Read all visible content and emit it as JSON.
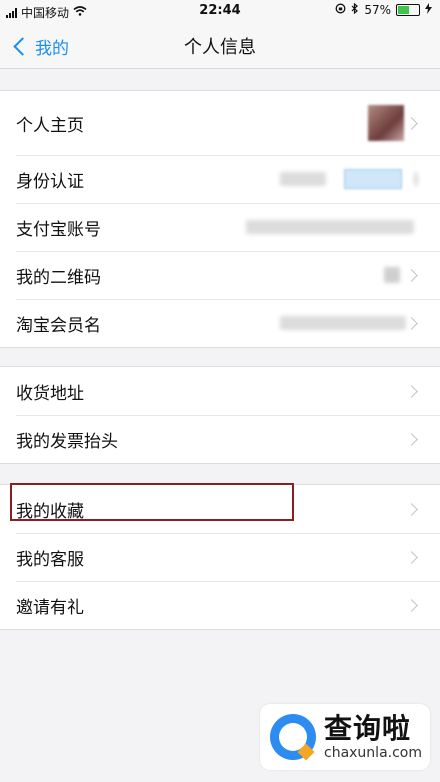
{
  "status_bar": {
    "carrier": "中国移动",
    "time": "22:44",
    "battery_percent": "57%",
    "battery_level": 0.57
  },
  "nav": {
    "back_label": "我的",
    "title": "个人信息"
  },
  "group1": [
    {
      "label": "个人主页"
    },
    {
      "label": "身份认证"
    },
    {
      "label": "支付宝账号"
    },
    {
      "label": "我的二维码"
    },
    {
      "label": "淘宝会员名"
    }
  ],
  "group2": [
    {
      "label": "收货地址"
    },
    {
      "label": "我的发票抬头"
    }
  ],
  "group3": [
    {
      "label": "我的收藏"
    },
    {
      "label": "我的客服"
    },
    {
      "label": "邀请有礼"
    }
  ],
  "watermark": {
    "name": "查询啦",
    "domain": "chaxunla.com"
  },
  "colors": {
    "accent": "#1a8ff0",
    "highlight_border": "#8a1f22"
  }
}
